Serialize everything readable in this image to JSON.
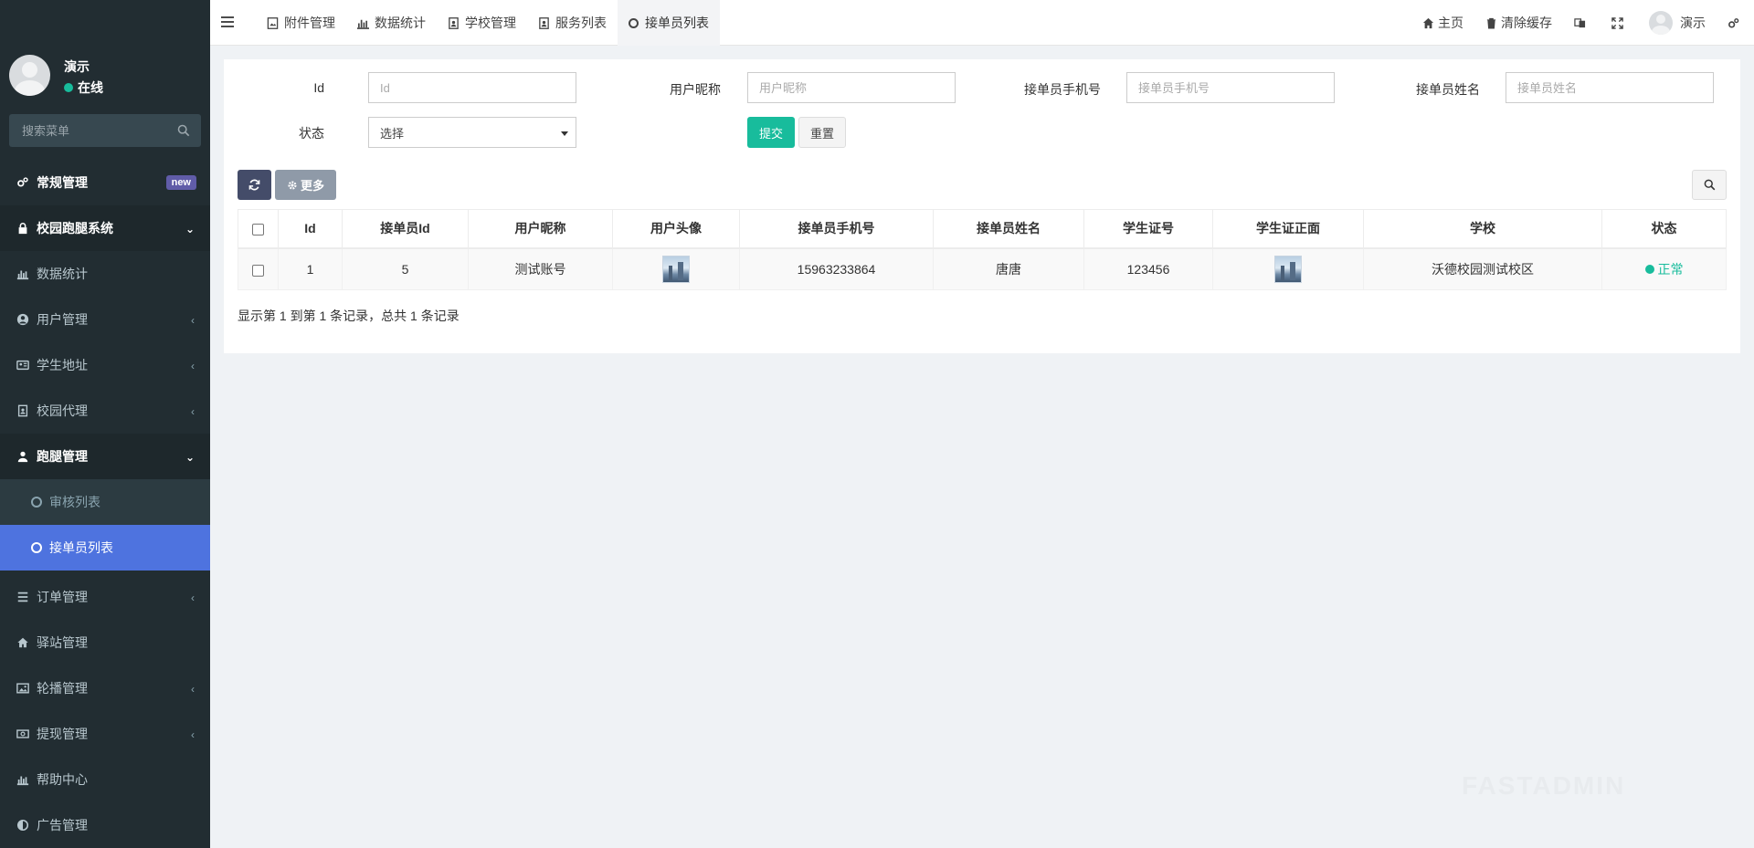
{
  "user": {
    "name": "演示",
    "status": "在线"
  },
  "sidebar": {
    "search_placeholder": "搜索菜单",
    "items": [
      {
        "label": "常规管理",
        "badge": "new"
      },
      {
        "label": "校园跑腿系统"
      },
      {
        "label": "数据统计"
      },
      {
        "label": "用户管理"
      },
      {
        "label": "学生地址"
      },
      {
        "label": "校园代理"
      },
      {
        "label": "跑腿管理"
      },
      {
        "label": "订单管理"
      },
      {
        "label": "驿站管理"
      },
      {
        "label": "轮播管理"
      },
      {
        "label": "提现管理"
      },
      {
        "label": "帮助中心"
      },
      {
        "label": "广告管理"
      }
    ],
    "sub_items": [
      {
        "label": "审核列表"
      },
      {
        "label": "接单员列表"
      }
    ]
  },
  "topbar": {
    "tabs": [
      {
        "label": "附件管理"
      },
      {
        "label": "数据统计"
      },
      {
        "label": "学校管理"
      },
      {
        "label": "服务列表"
      },
      {
        "label": "接单员列表"
      }
    ],
    "home": "主页",
    "clear_cache": "清除缓存",
    "username": "演示"
  },
  "filters": {
    "id": {
      "label": "Id",
      "placeholder": "Id"
    },
    "nickname": {
      "label": "用户昵称",
      "placeholder": "用户昵称"
    },
    "phone": {
      "label": "接单员手机号",
      "placeholder": "接单员手机号"
    },
    "realname": {
      "label": "接单员姓名",
      "placeholder": "接单员姓名"
    },
    "status": {
      "label": "状态",
      "value": "选择"
    },
    "submit": "提交",
    "reset": "重置"
  },
  "toolbar": {
    "more": "更多"
  },
  "table": {
    "headers": [
      "Id",
      "接单员Id",
      "用户昵称",
      "用户头像",
      "接单员手机号",
      "接单员姓名",
      "学生证号",
      "学生证正面",
      "学校",
      "状态"
    ],
    "rows": [
      {
        "id": "1",
        "runner_id": "5",
        "nickname": "测试账号",
        "phone": "15963233864",
        "name": "唐唐",
        "student_no": "123456",
        "school": "沃德校园测试校区",
        "status": "正常"
      }
    ]
  },
  "pagination": {
    "info": "显示第 1 到第 1 条记录，总共 1 条记录"
  },
  "watermark": "FASTADMIN",
  "colors": {
    "sidebar_bg": "#222d32",
    "active_blue": "#4e73df",
    "accent_green": "#18bc9c",
    "badge_purple": "#605ca8"
  }
}
